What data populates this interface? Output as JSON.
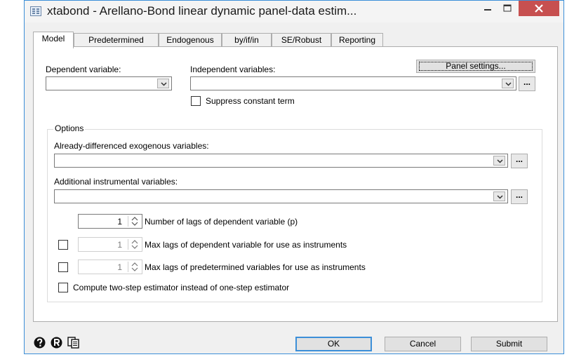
{
  "window": {
    "title": "xtabond - Arellano-Bond linear dynamic panel-data estim..."
  },
  "tabs": [
    {
      "label": "Model",
      "active": true
    },
    {
      "label": "Predetermined",
      "active": false
    },
    {
      "label": "Endogenous",
      "active": false
    },
    {
      "label": "by/if/in",
      "active": false
    },
    {
      "label": "SE/Robust",
      "active": false
    },
    {
      "label": "Reporting",
      "active": false
    }
  ],
  "model": {
    "dependent_label": "Dependent variable:",
    "independent_label": "Independent variables:",
    "panel_settings_label": "Panel settings...",
    "suppress_label": "Suppress constant term",
    "ellipsis": "..."
  },
  "options": {
    "title": "Options",
    "already_diff_label": "Already-differenced exogenous variables:",
    "additional_instr_label": "Additional instrumental variables:",
    "lags_value": "1",
    "lags_label": "Number of lags of dependent variable (p)",
    "maxlags_dep_value": "1",
    "maxlags_dep_label": "Max lags of dependent variable for use as instruments",
    "maxlags_pre_value": "1",
    "maxlags_pre_label": "Max lags of predetermined variables for use as instruments",
    "twostep_label": "Compute two-step estimator instead of one-step estimator"
  },
  "footer": {
    "ok_label": "OK",
    "cancel_label": "Cancel",
    "submit_label": "Submit"
  },
  "colors": {
    "accent": "#3c8fd8",
    "close": "#c75050"
  }
}
